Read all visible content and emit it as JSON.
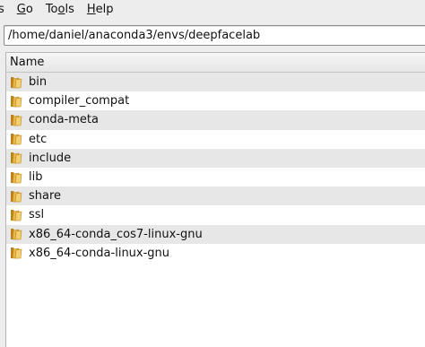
{
  "menubar": {
    "items": [
      {
        "pre": "",
        "mnemonic": "",
        "post": "s"
      },
      {
        "pre": "",
        "mnemonic": "G",
        "post": "o"
      },
      {
        "pre": "To",
        "mnemonic": "o",
        "post": "ls"
      },
      {
        "pre": "",
        "mnemonic": "H",
        "post": "elp"
      }
    ]
  },
  "location": {
    "value": "/home/daniel/anaconda3/envs/deepfacelab"
  },
  "list": {
    "column_name": "Name",
    "items": [
      {
        "label": "bin",
        "icon": "folder-icon"
      },
      {
        "label": "compiler_compat",
        "icon": "folder-icon"
      },
      {
        "label": "conda-meta",
        "icon": "folder-icon"
      },
      {
        "label": "etc",
        "icon": "folder-icon"
      },
      {
        "label": "include",
        "icon": "folder-icon"
      },
      {
        "label": "lib",
        "icon": "folder-icon"
      },
      {
        "label": "share",
        "icon": "folder-icon"
      },
      {
        "label": "ssl",
        "icon": "folder-icon"
      },
      {
        "label": "x86_64-conda_cos7-linux-gnu",
        "icon": "folder-icon"
      },
      {
        "label": "x86_64-conda-linux-gnu",
        "icon": "folder-icon"
      }
    ]
  },
  "colors": {
    "folder": "#e8b84a",
    "folder_dark": "#b9841f",
    "row_alt": "#e7e7e7"
  }
}
